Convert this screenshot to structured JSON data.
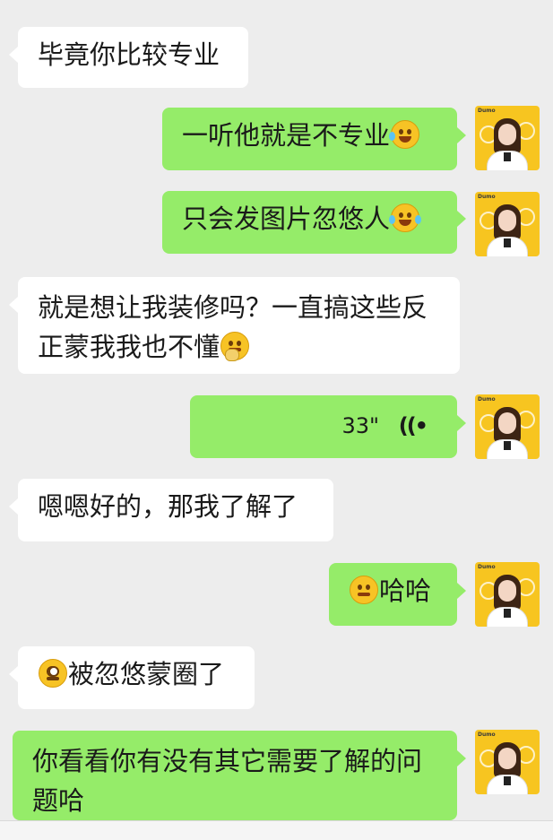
{
  "messages": [
    {
      "side": "left",
      "text": "毕竟你比较专业"
    },
    {
      "side": "right",
      "text": "一听他就是不专业",
      "emoji": "laugh-cry-emoji"
    },
    {
      "side": "right",
      "text": "只会发图片忽悠人",
      "emoji": "tears-of-joy-emoji"
    },
    {
      "side": "left",
      "text": "就是想让我装修吗？一直搞这些反正蒙我我也不懂",
      "emoji": "thinking-emoji"
    },
    {
      "side": "right",
      "type": "voice",
      "duration": "33\"",
      "icon": "voice-wave-icon"
    },
    {
      "side": "left",
      "text": "嗯嗯好的，那我了解了"
    },
    {
      "side": "right",
      "text": "哈哈",
      "emoji": "smirk-emoji"
    },
    {
      "side": "left",
      "text": "被忽悠蒙圈了",
      "emoji": "stunned-emoji"
    },
    {
      "side": "right",
      "text": "你看看你有没有其它需要了解的问题哈"
    }
  ],
  "colors": {
    "background": "#ededed",
    "incoming_bubble": "#ffffff",
    "outgoing_bubble": "#95ec69"
  }
}
